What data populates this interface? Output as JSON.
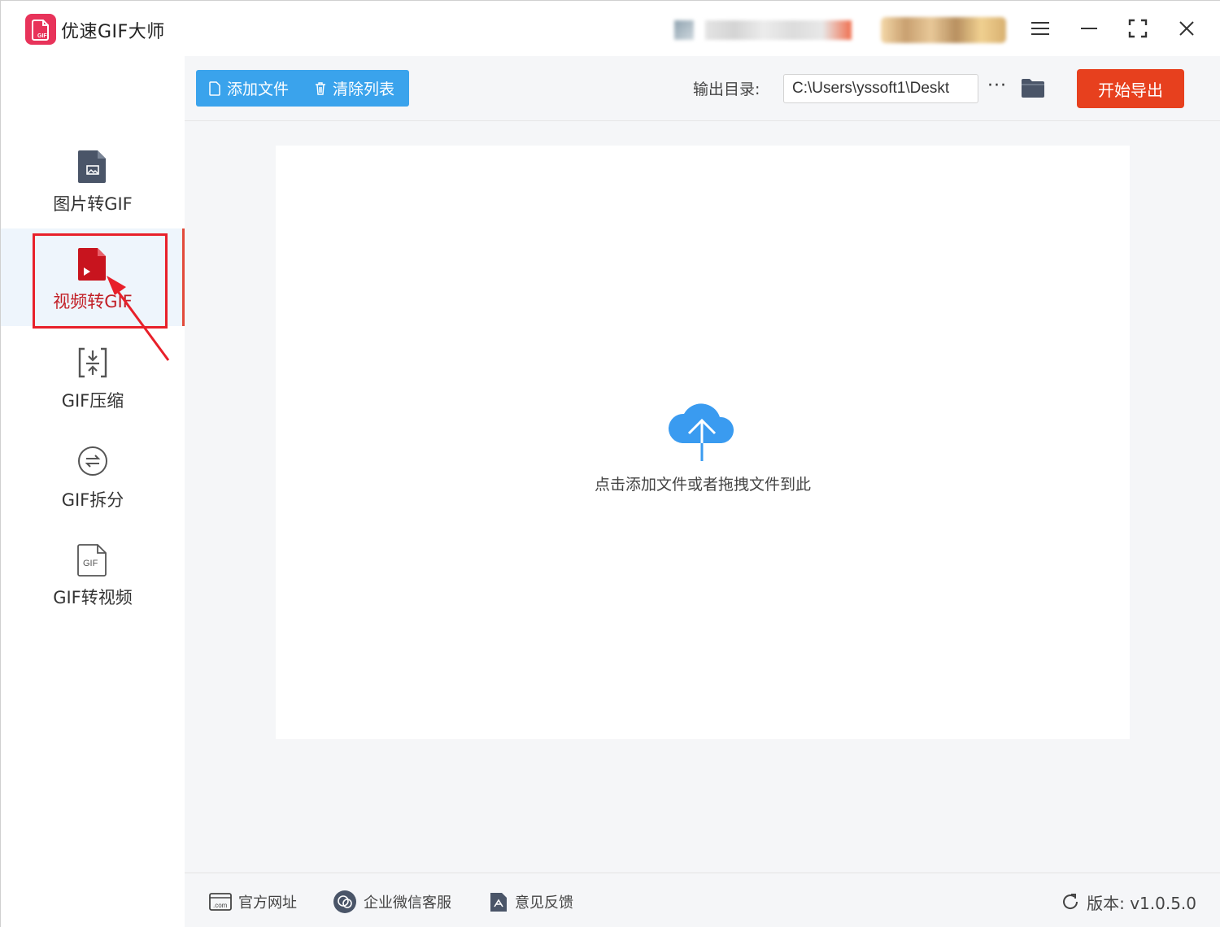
{
  "app": {
    "title": "优速GIF大师"
  },
  "sidebar": {
    "items": [
      {
        "label": "图片转GIF",
        "icon": "image-file-icon"
      },
      {
        "label": "视频转GIF",
        "icon": "video-file-icon",
        "active": true
      },
      {
        "label": "GIF压缩",
        "icon": "compress-icon"
      },
      {
        "label": "GIF拆分",
        "icon": "split-icon"
      },
      {
        "label": "GIF转视频",
        "icon": "gif-file-icon"
      }
    ]
  },
  "toolbar": {
    "add_label": "添加文件",
    "clear_label": "清除列表",
    "output_label": "输出目录:",
    "output_path": "C:\\Users\\yssoft1\\Deskt",
    "more_label": "···",
    "start_label": "开始导出"
  },
  "dropzone": {
    "text": "点击添加文件或者拖拽文件到此"
  },
  "footer": {
    "website_label": "官方网址",
    "wechat_label": "企业微信客服",
    "feedback_label": "意见反馈",
    "version_label": "版本: v1.0.5.0"
  },
  "colors": {
    "accent_blue": "#3aa3ec",
    "start_button": "#e7401e",
    "active_text": "#c21f26",
    "annotation_red": "#e8202a",
    "logo_pink": "#e8335a",
    "cloud_blue": "#3a9bf0"
  }
}
